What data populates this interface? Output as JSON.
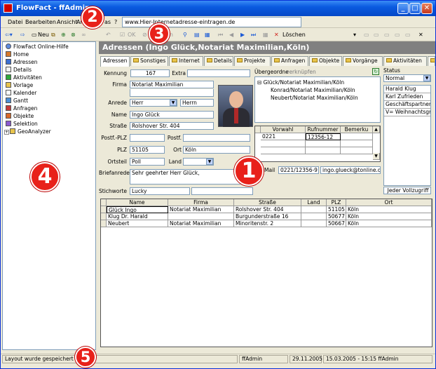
{
  "window": {
    "title": "FlowFact - ffAdmin"
  },
  "menu": [
    "Datei",
    "Bearbeiten",
    "Ansicht",
    "Arc",
    "as",
    "?"
  ],
  "url_value": "www.Hier-Internetadresse-eintragen.de",
  "toolbar": {
    "new_label": "Neu",
    "ok_label": "OK",
    "delete_label": "Löschen",
    "en_label": "en"
  },
  "sidebar": {
    "items": [
      "FlowFact Online-Hilfe",
      "Home",
      "Adressen",
      "Details",
      "Aktivitäten",
      "Vorlage",
      "Kalender",
      "Gantt",
      "Anfragen",
      "Objekte",
      "Selektion",
      "GeoAnalyzer"
    ]
  },
  "page_title": "Adressen (Ingo Glück,Notariat Maximilian,Köln)",
  "tabs": [
    "Adressen",
    "Sonstiges",
    "Internet",
    "Details",
    "Projekte",
    "Anfragen",
    "Objekte",
    "Vorgänge",
    "Aktivitäten",
    "S"
  ],
  "form": {
    "kennung_label": "Kennung",
    "kennung_value": "167",
    "extra_label": "Extra",
    "firma_label": "Firma",
    "firma_value": "Notariat Maximilian",
    "anrede_label": "Anrede",
    "anrede_value": "Herr",
    "anrede2_value": "Herrn",
    "name_label": "Name",
    "name_value": "Ingo Glück",
    "strasse_label": "Straße",
    "strasse_value": "Rolshover Str. 404",
    "postfplz_label": "Postf.-PLZ",
    "postf_label": "Postf.",
    "plz_label": "PLZ",
    "plz_value": "51105",
    "ort_label": "Ort",
    "ort_value": "Köln",
    "ortsteil_label": "Ortsteil",
    "ortsteil_value": "Poll",
    "land_label": "Land",
    "briefanrede_label": "Briefanrede",
    "briefanrede_value": "Sehr geehrter Herr Glück,",
    "stichworte_label": "Stichworte",
    "stichworte_value": "Lucky"
  },
  "parent": {
    "label": "Übergeordne",
    "link": "verknüpfen",
    "tree": [
      "Glück/Notariat Maximilian/Köln",
      "Konrad/Notariat Maximilian/Köln",
      "Neubert/Notariat Maximilian/Köln"
    ]
  },
  "phones": {
    "headers": [
      "Vorwahl",
      "Rufnummer",
      "Bemerku"
    ],
    "rows": [
      [
        "0221",
        "12356-12",
        ""
      ]
    ]
  },
  "contact": {
    "mail_label": "Mail",
    "phone_value": "0221/12356-9",
    "email_value": "ingo.glueck@tonline.de"
  },
  "status": {
    "label": "Status",
    "value": "Normal",
    "items": [
      "Harald Klug",
      "Karl Zufrieden",
      "Geschäftspartner",
      "V= Weihnachtsgruß"
    ],
    "footer": "Jeder Vollzugriff"
  },
  "table": {
    "headers": [
      "Name",
      "Firma",
      "Straße",
      "Land",
      "PLZ",
      "Ort"
    ],
    "rows": [
      [
        "Glück Ingo",
        "Notariat Maximilian",
        "Rolshover Str. 404",
        "",
        "51105",
        "Köln"
      ],
      [
        "Klug Dr. Harald",
        "",
        "Burgunderstraße 16",
        "",
        "50677",
        "Köln"
      ],
      [
        "Neubert",
        "Notariat Maximilian",
        "Minoritenstr. 2",
        "",
        "50667",
        "Köln"
      ]
    ]
  },
  "statusbar": {
    "message": "Layout wurde gespeichert",
    "user": "ffAdmin",
    "date": "29.11.2005",
    "stamp": "15.03.2005 - 15:15 ffAdmin"
  },
  "badges": [
    "1",
    "2",
    "3",
    "4",
    "5"
  ],
  "colors": {
    "badge": "#e8211a",
    "title_blue": "#0a5ae0",
    "header_gray": "#808080"
  }
}
